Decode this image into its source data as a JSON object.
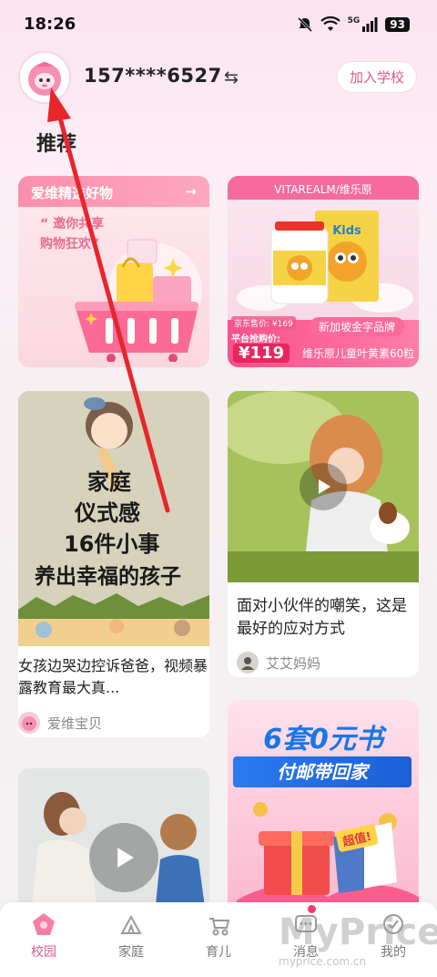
{
  "status": {
    "time": "18:26",
    "network": "5G",
    "battery": "93"
  },
  "header": {
    "username": "157****6527",
    "switch_icon": "⇆",
    "join_label": "加入学校"
  },
  "section_title": "推荐",
  "cards": {
    "goods": {
      "title": "爱维精选好物",
      "arrow": "→",
      "quote_line1": "“ 邀你共享",
      "quote_line2": "购物狂欢”"
    },
    "vitamin": {
      "brand": "VITAREALM/维乐原",
      "jd_price": "京东售价: ¥169",
      "platform_label": "平台抢购价:",
      "price": "¥119",
      "tag": "新加坡金字品牌",
      "name": "维乐原儿童叶黄素60粒"
    },
    "ritual": {
      "art_line1": "家庭",
      "art_line2": "仪式感",
      "art_line3": "16件小事",
      "art_line4": "养出幸福的孩子",
      "title": "女孩边哭边控诉爸爸，视频暴露教育最大真...",
      "author": "爱维宝贝"
    },
    "mockery": {
      "title": "面对小伙伴的嘲笑，这是最好的应对方式",
      "author": "艾艾妈妈"
    },
    "books": {
      "headline": "6套0元书",
      "banner": "付邮带回家",
      "badge": "超值!"
    }
  },
  "nav": [
    {
      "label": "校园",
      "icon": "campus-icon",
      "active": true
    },
    {
      "label": "家庭",
      "icon": "family-icon"
    },
    {
      "label": "育儿",
      "icon": "stroller-icon"
    },
    {
      "label": "消息",
      "icon": "message-icon",
      "badge": true
    },
    {
      "label": "我的",
      "icon": "profile-icon"
    }
  ],
  "watermark": {
    "text": "MyPrice",
    "sub": "myprice.com.cn"
  },
  "colors": {
    "accent": "#e05a8a",
    "arrow": "#e8252b"
  }
}
